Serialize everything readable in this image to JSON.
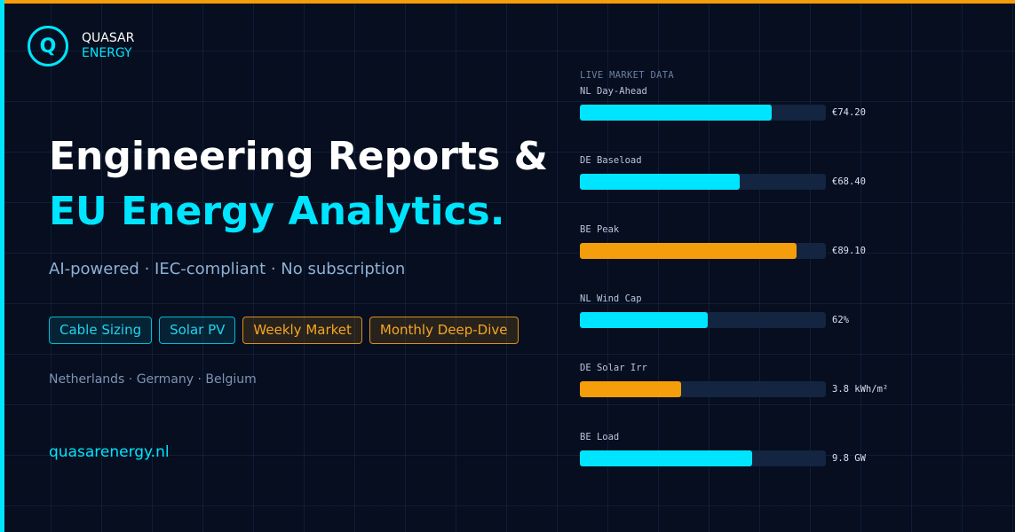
{
  "brand": {
    "badge": "Q",
    "name_line1": "QUASAR",
    "name_line2": "ENERGY"
  },
  "hero": {
    "title_line1": "Engineering Reports &",
    "title_line2": "EU Energy Analytics.",
    "subtitle": "AI-powered · IEC-compliant · No subscription"
  },
  "tags": [
    {
      "label": "Cable Sizing",
      "style": "cyan"
    },
    {
      "label": "Solar PV",
      "style": "cyan"
    },
    {
      "label": "Weekly Market",
      "style": "amber"
    },
    {
      "label": "Monthly Deep-Dive",
      "style": "amber"
    }
  ],
  "countries": "Netherlands · Germany · Belgium",
  "website": "quasarenergy.nl",
  "market": {
    "heading": "LIVE MARKET DATA",
    "metrics": [
      {
        "label": "NL Day-Ahead",
        "value": "€74.20",
        "fraction": 0.78,
        "color": "#00e5ff"
      },
      {
        "label": "DE Baseload",
        "value": "€68.40",
        "fraction": 0.65,
        "color": "#00e5ff"
      },
      {
        "label": "BE Peak",
        "value": "€89.10",
        "fraction": 0.88,
        "color": "#f59e0b"
      },
      {
        "label": "NL Wind Cap",
        "value": "62%",
        "fraction": 0.52,
        "color": "#00e5ff"
      },
      {
        "label": "DE Solar Irr",
        "value": "3.8 kWh/m²",
        "fraction": 0.41,
        "color": "#f59e0b"
      },
      {
        "label": "BE Load",
        "value": "9.8 GW",
        "fraction": 0.7,
        "color": "#00e5ff"
      }
    ]
  },
  "colors": {
    "accent_cyan": "#00e5ff",
    "accent_amber": "#f59e0b",
    "background": "#060e1f"
  }
}
